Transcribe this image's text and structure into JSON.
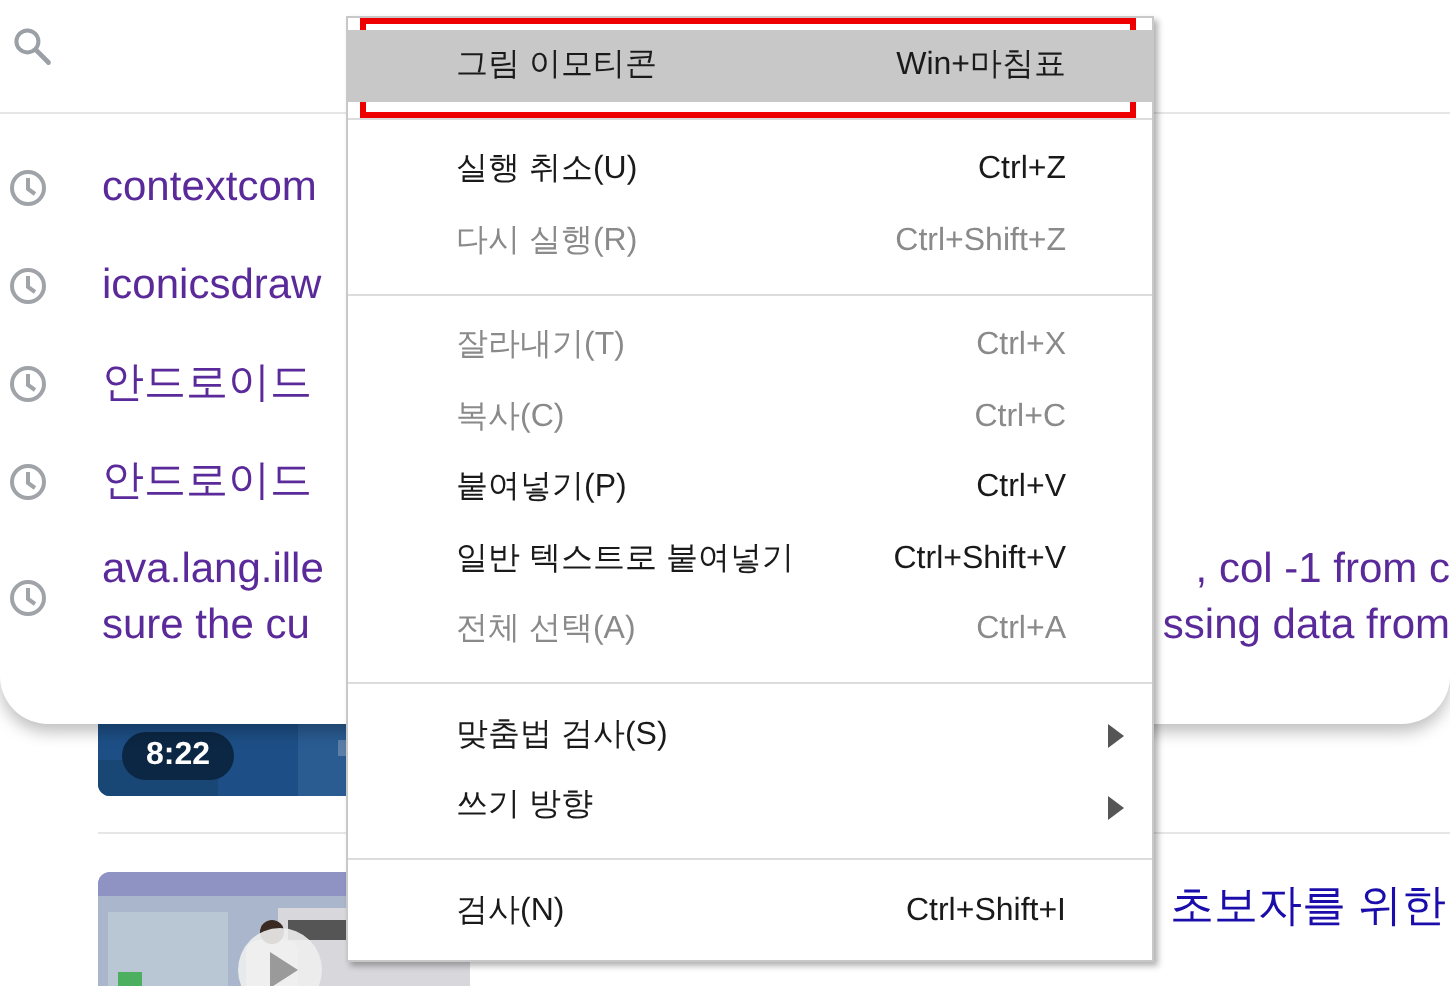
{
  "search_suggestions": [
    {
      "lines": [
        {
          "left": "contextcom"
        }
      ]
    },
    {
      "lines": [
        {
          "left": "iconicsdraw"
        }
      ]
    },
    {
      "lines": [
        {
          "left": "안드로이드"
        }
      ]
    },
    {
      "lines": [
        {
          "left": "안드로이드"
        }
      ]
    },
    {
      "lines": [
        {
          "left": "ava.lang.ille",
          "right": ", col -1 from c"
        },
        {
          "left": "sure the cu",
          "right": "ssing data from"
        }
      ]
    }
  ],
  "videos": [
    {
      "duration": "8:22"
    },
    {
      "play": true,
      "title": "초보자를 위한"
    }
  ],
  "context_menu": {
    "items": [
      {
        "kind": "item",
        "label": "그림 이모티콘",
        "shortcut": "Win+마침표",
        "selected": true,
        "disabled": false
      },
      {
        "kind": "separator"
      },
      {
        "kind": "item",
        "label": "실행 취소(U)",
        "shortcut": "Ctrl+Z",
        "selected": false,
        "disabled": false
      },
      {
        "kind": "item",
        "label": "다시 실행(R)",
        "shortcut": "Ctrl+Shift+Z",
        "selected": false,
        "disabled": true
      },
      {
        "kind": "separator"
      },
      {
        "kind": "item",
        "label": "잘라내기(T)",
        "shortcut": "Ctrl+X",
        "selected": false,
        "disabled": true
      },
      {
        "kind": "item",
        "label": "복사(C)",
        "shortcut": "Ctrl+C",
        "selected": false,
        "disabled": true
      },
      {
        "kind": "item",
        "label": "붙여넣기(P)",
        "shortcut": "Ctrl+V",
        "selected": false,
        "disabled": false
      },
      {
        "kind": "item",
        "label": "일반 텍스트로 붙여넣기",
        "shortcut": "Ctrl+Shift+V",
        "selected": false,
        "disabled": false
      },
      {
        "kind": "item",
        "label": "전체 선택(A)",
        "shortcut": "Ctrl+A",
        "selected": false,
        "disabled": true
      },
      {
        "kind": "separator"
      },
      {
        "kind": "submenu",
        "label": "맞춤법 검사(S)",
        "selected": false,
        "disabled": false
      },
      {
        "kind": "submenu",
        "label": "쓰기 방향",
        "selected": false,
        "disabled": false
      },
      {
        "kind": "separator"
      },
      {
        "kind": "item",
        "label": "검사(N)",
        "shortcut": "Ctrl+Shift+I",
        "selected": false,
        "disabled": false
      }
    ]
  }
}
